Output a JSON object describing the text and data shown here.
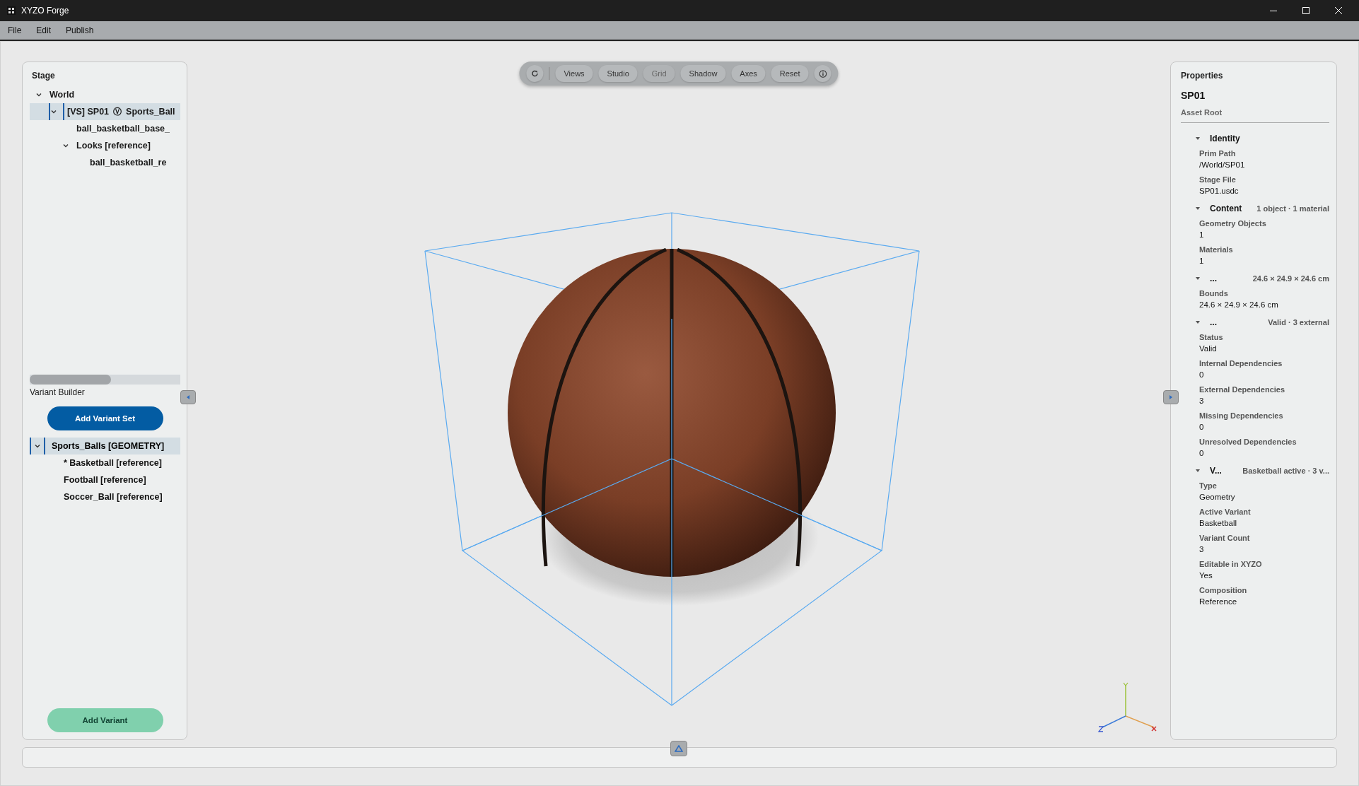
{
  "window": {
    "title": "XYZO Forge"
  },
  "menu": [
    {
      "label": "File"
    },
    {
      "label": "Edit"
    },
    {
      "label": "Publish"
    }
  ],
  "stage": {
    "title": "Stage",
    "tree": [
      {
        "label": "World",
        "expanded": true,
        "selected": false,
        "children": [
          {
            "label": "[VS] SP01",
            "badge": "Ⓥ",
            "name": "Sports_Ball",
            "expanded": true,
            "selected": true,
            "children": [
              {
                "label": "ball_basketball_base_",
                "selected": false
              },
              {
                "label": "Looks  [reference]",
                "expanded": true,
                "selected": false,
                "children": [
                  {
                    "label": "ball_basketball_re",
                    "selected": false
                  }
                ]
              }
            ]
          }
        ]
      }
    ]
  },
  "variant_builder": {
    "title": "Variant Builder",
    "add_set_button": "Add Variant Set",
    "add_button": "Add Variant",
    "sets": [
      {
        "label": "Sports_Balls [GEOMETRY]",
        "expanded": true,
        "selected": true,
        "variants": [
          {
            "label": "* Basketball [reference]"
          },
          {
            "label": "Football [reference]"
          },
          {
            "label": "Soccer_Ball [reference]"
          }
        ]
      }
    ]
  },
  "toolbar": {
    "buttons": [
      {
        "label": "Views",
        "disabled": false
      },
      {
        "label": "Studio",
        "disabled": false
      },
      {
        "label": "Grid",
        "disabled": true
      },
      {
        "label": "Shadow",
        "disabled": false
      },
      {
        "label": "Axes",
        "disabled": false
      },
      {
        "label": "Reset",
        "disabled": false
      }
    ]
  },
  "properties": {
    "title": "Properties",
    "name": "SP01",
    "subtitle": "Asset Root",
    "sections": [
      {
        "title": "Identity",
        "expanded": true,
        "fields": [
          {
            "label": "Prim Path",
            "value": "/World/SP01"
          },
          {
            "label": "Stage File",
            "value": "SP01.usdc"
          }
        ]
      },
      {
        "title": "Content",
        "summary": "1 object · 1 material",
        "expanded": true,
        "fields": [
          {
            "label": "Geometry Objects",
            "value": "1"
          },
          {
            "label": "Materials",
            "value": "1"
          }
        ]
      },
      {
        "title": "...",
        "summary": "24.6 × 24.9 × 24.6 cm",
        "expanded": true,
        "fields": [
          {
            "label": "Bounds",
            "value": "24.6 × 24.9 × 24.6 cm"
          }
        ]
      },
      {
        "title": "...",
        "summary": "Valid · 3 external",
        "expanded": true,
        "fields": [
          {
            "label": "Status",
            "value": "Valid"
          },
          {
            "label": "Internal Dependencies",
            "value": "0"
          },
          {
            "label": "External Dependencies",
            "value": "3"
          },
          {
            "label": "Missing Dependencies",
            "value": "0"
          },
          {
            "label": "Unresolved Dependencies",
            "value": "0"
          }
        ]
      },
      {
        "title": "V...",
        "summary": "Basketball active · 3 v...",
        "expanded": true,
        "fields": [
          {
            "label": "Type",
            "value": "Geometry"
          },
          {
            "label": "Active Variant",
            "value": "Basketball"
          },
          {
            "label": "Variant Count",
            "value": "3"
          },
          {
            "label": "Editable in XYZO",
            "value": "Yes"
          },
          {
            "label": "Composition",
            "value": "Reference"
          }
        ]
      }
    ]
  }
}
